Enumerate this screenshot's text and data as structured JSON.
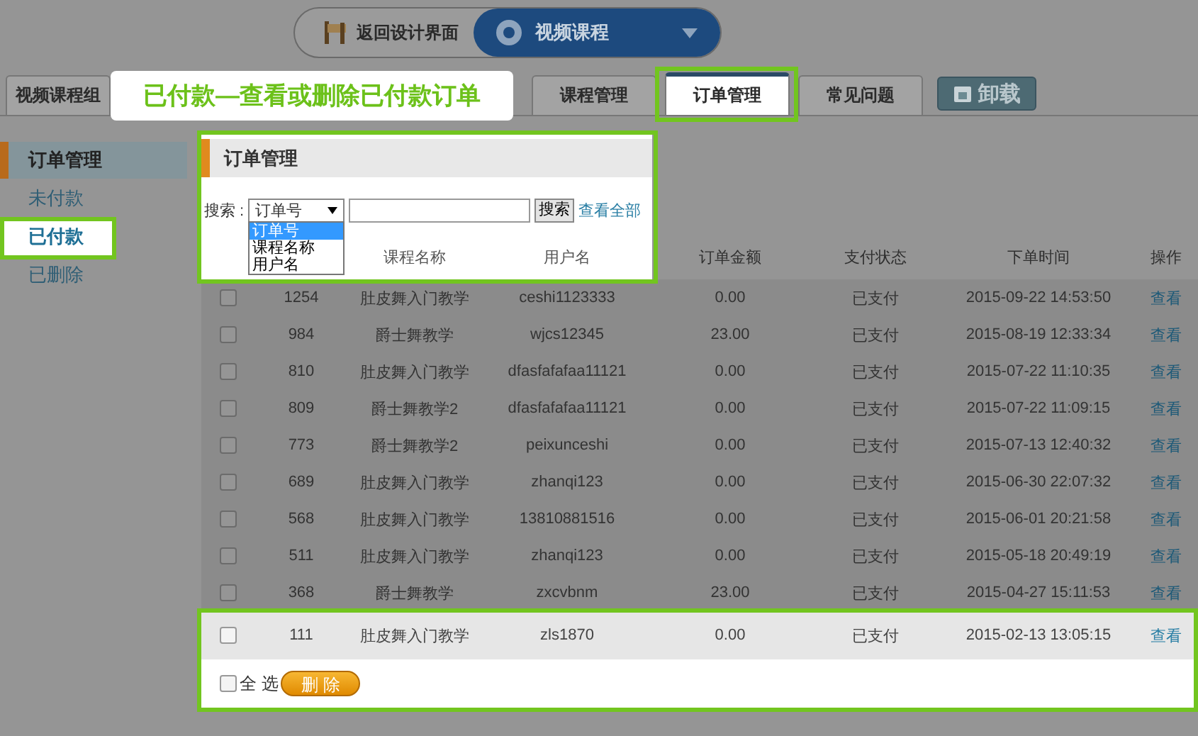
{
  "header": {
    "back_button": "返回设计界面",
    "app_selector": "视频课程"
  },
  "tabs": [
    {
      "label": "视频课程组",
      "selected": false,
      "highlighted": false
    },
    {
      "label": "课程管理",
      "selected": false,
      "highlighted": false
    },
    {
      "label": "订单管理",
      "selected": true,
      "highlighted": true
    },
    {
      "label": "常见问题",
      "selected": false,
      "highlighted": false
    }
  ],
  "uninstall_button": "卸载",
  "callout": "已付款—查看或删除已付款订单",
  "sidebar": {
    "title": "订单管理",
    "items": [
      {
        "label": "未付款",
        "selected": false,
        "highlighted": false
      },
      {
        "label": "已付款",
        "selected": true,
        "highlighted": true
      },
      {
        "label": "已删除",
        "selected": false,
        "highlighted": false
      }
    ]
  },
  "panel": {
    "title": "订单管理",
    "search": {
      "label": "搜索 :",
      "select_value": "订单号",
      "options": [
        {
          "label": "订单号",
          "selected": true
        },
        {
          "label": "课程名称",
          "selected": false
        },
        {
          "label": "用户名",
          "selected": false
        }
      ],
      "button": "搜索",
      "view_all": "查看全部"
    }
  },
  "table": {
    "columns": [
      "课程名称",
      "用户名",
      "订单金额",
      "支付状态",
      "下单时间",
      "操作"
    ],
    "rows": [
      {
        "id": "1254",
        "course": "肚皮舞入门教学",
        "user": "ceshi1123333",
        "amount": "0.00",
        "status": "已支付",
        "time": "2015-09-22 14:53:50",
        "action": "查看",
        "checked": false,
        "highlighted": false
      },
      {
        "id": "984",
        "course": "爵士舞教学",
        "user": "wjcs12345",
        "amount": "23.00",
        "status": "已支付",
        "time": "2015-08-19 12:33:34",
        "action": "查看",
        "checked": false,
        "highlighted": false
      },
      {
        "id": "810",
        "course": "肚皮舞入门教学",
        "user": "dfasfafafaa11121",
        "amount": "0.00",
        "status": "已支付",
        "time": "2015-07-22 11:10:35",
        "action": "查看",
        "checked": false,
        "highlighted": false
      },
      {
        "id": "809",
        "course": "爵士舞教学2",
        "user": "dfasfafafaa11121",
        "amount": "0.00",
        "status": "已支付",
        "time": "2015-07-22 11:09:15",
        "action": "查看",
        "checked": false,
        "highlighted": false
      },
      {
        "id": "773",
        "course": "爵士舞教学2",
        "user": "peixunceshi",
        "amount": "0.00",
        "status": "已支付",
        "time": "2015-07-13 12:40:32",
        "action": "查看",
        "checked": false,
        "highlighted": false
      },
      {
        "id": "689",
        "course": "肚皮舞入门教学",
        "user": "zhanqi123",
        "amount": "0.00",
        "status": "已支付",
        "time": "2015-06-30 22:07:32",
        "action": "查看",
        "checked": false,
        "highlighted": false
      },
      {
        "id": "568",
        "course": "肚皮舞入门教学",
        "user": "13810881516",
        "amount": "0.00",
        "status": "已支付",
        "time": "2015-06-01 20:21:58",
        "action": "查看",
        "checked": false,
        "highlighted": false
      },
      {
        "id": "511",
        "course": "肚皮舞入门教学",
        "user": "zhanqi123",
        "amount": "0.00",
        "status": "已支付",
        "time": "2015-05-18 20:49:19",
        "action": "查看",
        "checked": false,
        "highlighted": false
      },
      {
        "id": "368",
        "course": "爵士舞教学",
        "user": "zxcvbnm",
        "amount": "23.00",
        "status": "已支付",
        "time": "2015-04-27 15:11:53",
        "action": "查看",
        "checked": false,
        "highlighted": false
      },
      {
        "id": "111",
        "course": "肚皮舞入门教学",
        "user": "zls1870",
        "amount": "0.00",
        "status": "已支付",
        "time": "2015-02-13 13:05:15",
        "action": "查看",
        "checked": false,
        "highlighted": true
      }
    ]
  },
  "footer": {
    "select_all": "全 选",
    "select_all_checked": false,
    "delete_button": "删 除"
  }
}
